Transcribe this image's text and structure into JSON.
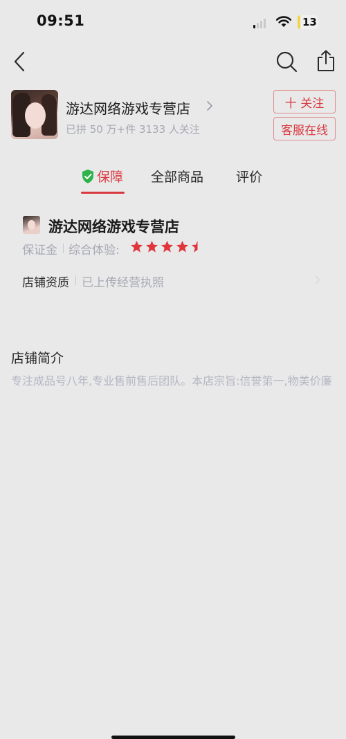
{
  "status_bar": {
    "time": "09:51",
    "battery": "13"
  },
  "shop": {
    "name": "游达网络游戏专营店",
    "stats": "已拼 50 万+件  3133 人关注",
    "follow_label": "十 关注",
    "service_label": "客服在线"
  },
  "tabs": [
    {
      "label": "保障",
      "active": true
    },
    {
      "label": "全部商品",
      "active": false
    },
    {
      "label": "评价",
      "active": false
    }
  ],
  "guarantee": {
    "store_name": "游达网络游戏专营店",
    "deposit_label": "保证金",
    "experience_label": "综合体验:",
    "rating": 4.5,
    "qualification_label": "店铺资质",
    "qualification_value": "已上传经营执照"
  },
  "intro": {
    "title": "店铺简介",
    "text": "专注成品号八年,专业售前售后团队。本店宗旨:信誉第一,物美价廉"
  },
  "colors": {
    "accent": "#d9393f",
    "shield_green": "#2fb24b",
    "muted_text": "#a7a9b3"
  },
  "icons": [
    "back-icon",
    "search-icon",
    "share-icon",
    "chevron-right-icon",
    "shield-check-icon",
    "star-icon"
  ]
}
